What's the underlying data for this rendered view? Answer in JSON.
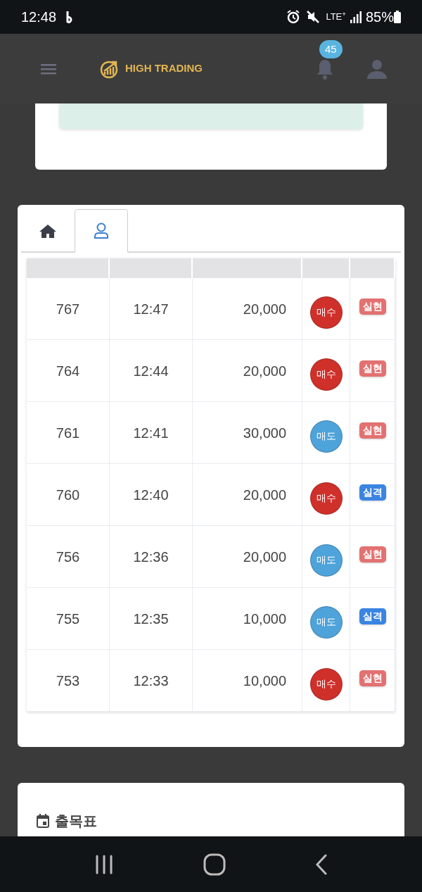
{
  "status_bar": {
    "time": "12:48",
    "network": "LTE$^{+}$",
    "battery": "85%"
  },
  "header": {
    "brand": "HIGH TRADING",
    "notification_count": "45"
  },
  "tabs": [
    {
      "kind": "home",
      "selected": false
    },
    {
      "kind": "user",
      "selected": true
    }
  ],
  "table": {
    "rows": [
      {
        "id": "767",
        "time": "12:47",
        "amount": "20,000",
        "side": {
          "label": "매수",
          "kind": "buy"
        },
        "result": {
          "label": "실현",
          "kind": "realized"
        }
      },
      {
        "id": "764",
        "time": "12:44",
        "amount": "20,000",
        "side": {
          "label": "매수",
          "kind": "buy"
        },
        "result": {
          "label": "실현",
          "kind": "realized"
        }
      },
      {
        "id": "761",
        "time": "12:41",
        "amount": "30,000",
        "side": {
          "label": "매도",
          "kind": "sell"
        },
        "result": {
          "label": "실현",
          "kind": "realized"
        }
      },
      {
        "id": "760",
        "time": "12:40",
        "amount": "20,000",
        "side": {
          "label": "매수",
          "kind": "buy"
        },
        "result": {
          "label": "실격",
          "kind": "failed"
        }
      },
      {
        "id": "756",
        "time": "12:36",
        "amount": "20,000",
        "side": {
          "label": "매도",
          "kind": "sell"
        },
        "result": {
          "label": "실현",
          "kind": "realized"
        }
      },
      {
        "id": "755",
        "time": "12:35",
        "amount": "10,000",
        "side": {
          "label": "매도",
          "kind": "sell"
        },
        "result": {
          "label": "실격",
          "kind": "failed"
        }
      },
      {
        "id": "753",
        "time": "12:33",
        "amount": "10,000",
        "side": {
          "label": "매수",
          "kind": "buy"
        },
        "result": {
          "label": "실현",
          "kind": "realized"
        }
      }
    ]
  },
  "attendance_card": {
    "title": "출목표"
  }
}
